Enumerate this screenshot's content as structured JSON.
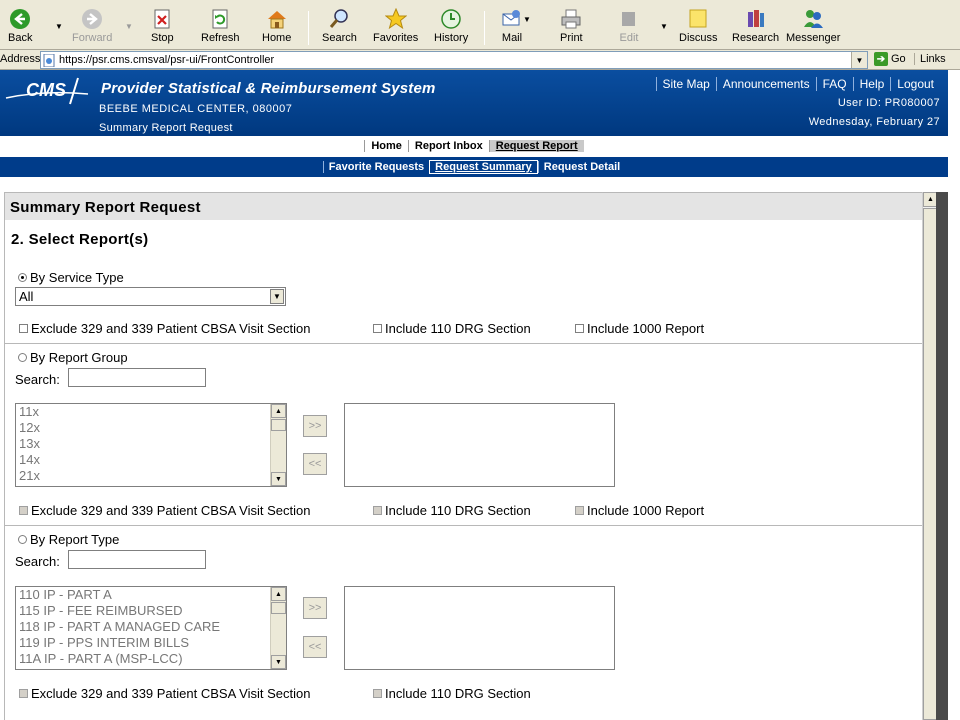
{
  "browser": {
    "toolbar": {
      "back": "Back",
      "forward": "Forward",
      "stop": "Stop",
      "refresh": "Refresh",
      "home": "Home",
      "search": "Search",
      "favorites": "Favorites",
      "history": "History",
      "mail": "Mail",
      "print": "Print",
      "edit": "Edit",
      "discuss": "Discuss",
      "research": "Research",
      "messenger": "Messenger"
    },
    "address_label": "Address",
    "url": "https://psr.cms.cmsval/psr-ui/FrontController",
    "go_label": "Go",
    "links_label": "Links"
  },
  "header": {
    "logo_text": "CMS",
    "title": "Provider Statistical & Reimbursement System",
    "provider": "BEEBE MEDICAL CENTER, 080007",
    "page_name": "Summary Report Request",
    "top_links": [
      "Site Map",
      "Announcements",
      "FAQ",
      "Help",
      "Logout"
    ],
    "user_id": "User ID: PR080007",
    "date": "Wednesday, February 27"
  },
  "nav_primary": [
    "Home",
    "Report Inbox",
    "Request Report"
  ],
  "nav_secondary": [
    "Favorite Requests",
    "Request Summary",
    "Request Detail"
  ],
  "panel": {
    "title": "Summary Report Request",
    "step": "2.  Select Report(s)",
    "service_type": {
      "label": "By Service Type",
      "selected": "All",
      "exclude": "Exclude 329 and 339 Patient CBSA Visit Section",
      "include110": "Include 110 DRG Section",
      "include1000": "Include 1000 Report"
    },
    "report_group": {
      "label": "By Report Group",
      "search_label": "Search:",
      "items": [
        "11x",
        "12x",
        "13x",
        "14x",
        "21x"
      ],
      "add_label": ">>",
      "remove_label": "<<",
      "exclude": "Exclude 329 and 339 Patient CBSA Visit Section",
      "include110": "Include 110 DRG Section",
      "include1000": "Include 1000 Report"
    },
    "report_type": {
      "label": "By Report Type",
      "search_label": "Search:",
      "items": [
        "110 IP - PART A",
        "115 IP - FEE REIMBURSED",
        "118 IP - PART A MANAGED CARE",
        "119 IP - PPS INTERIM BILLS",
        "11A IP - PART A (MSP-LCC)"
      ],
      "add_label": ">>",
      "remove_label": "<<",
      "exclude": "Exclude 329 and 339 Patient CBSA Visit Section",
      "include110": "Include 110 DRG Section"
    }
  },
  "colors": {
    "header_blue": "#00387f",
    "chrome": "#ece9d8"
  }
}
